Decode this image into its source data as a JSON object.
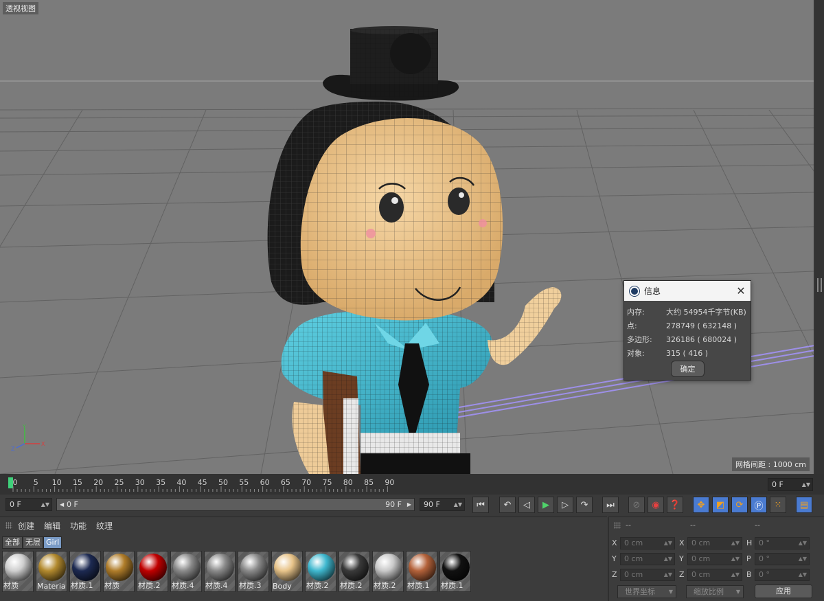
{
  "viewport": {
    "label": "透视视图",
    "grid_spacing": "网格间距 : 1000 cm",
    "axis": {
      "x": "X",
      "y": "Y",
      "z": "Z"
    }
  },
  "info_dialog": {
    "title": "信息",
    "close_icon": "close-icon",
    "rows": [
      {
        "key": "内存:",
        "value": "大约 54954千字节(KB)"
      },
      {
        "key": "点:",
        "value": "278749 ( 632148 )"
      },
      {
        "key": "多边形:",
        "value": "326186 ( 680024 )"
      },
      {
        "key": "对象:",
        "value": "315 ( 416 )"
      }
    ],
    "ok_label": "确定"
  },
  "timeline": {
    "ticks": [
      "0",
      "5",
      "10",
      "15",
      "20",
      "25",
      "30",
      "35",
      "40",
      "45",
      "50",
      "55",
      "60",
      "65",
      "70",
      "75",
      "80",
      "85",
      "90"
    ],
    "current_frame": "0 F"
  },
  "transport": {
    "start_frame": "0 F",
    "range_start": "0 F",
    "range_end": "90 F",
    "end_frame": "90 F"
  },
  "materials": {
    "menu": [
      "创建",
      "编辑",
      "功能",
      "纹理"
    ],
    "tabs": [
      "全部",
      "无层",
      "Girl"
    ],
    "active_tab": "Girl",
    "items": [
      {
        "name": "材质",
        "color": "#cfcfcf"
      },
      {
        "name": "Materia",
        "color": "#b38a2e"
      },
      {
        "name": "材质.1",
        "color": "#1d2a52"
      },
      {
        "name": "材质",
        "color": "#b07d2a"
      },
      {
        "name": "材质.2",
        "color": "#c00000"
      },
      {
        "name": "材质.4",
        "color": "#8a8a8a"
      },
      {
        "name": "材质.4",
        "color": "#8a8a8a"
      },
      {
        "name": "材质.3",
        "color": "#8a8a8a"
      },
      {
        "name": "Body",
        "color": "#e8c48a"
      },
      {
        "name": "材质.2",
        "color": "#3fb8cf"
      },
      {
        "name": "材质.2",
        "color": "#3a3a3a"
      },
      {
        "name": "材质.2",
        "color": "#c9c9c9"
      },
      {
        "name": "材质.1",
        "color": "#b4623a"
      },
      {
        "name": "材质.1",
        "color": "#111111"
      }
    ]
  },
  "coordinates": {
    "headers": [
      "--",
      "--",
      "--"
    ],
    "rows": [
      {
        "l1": "X",
        "v1": "0 cm",
        "l2": "X",
        "v2": "0 cm",
        "l3": "H",
        "v3": "0 °"
      },
      {
        "l1": "Y",
        "v1": "0 cm",
        "l2": "Y",
        "v2": "0 cm",
        "l3": "P",
        "v3": "0 °"
      },
      {
        "l1": "Z",
        "v1": "0 cm",
        "l2": "Z",
        "v2": "0 cm",
        "l3": "B",
        "v3": "0 °"
      }
    ],
    "coord_mode": "世界坐标",
    "scale_mode": "缩放比例",
    "apply_label": "应用"
  }
}
